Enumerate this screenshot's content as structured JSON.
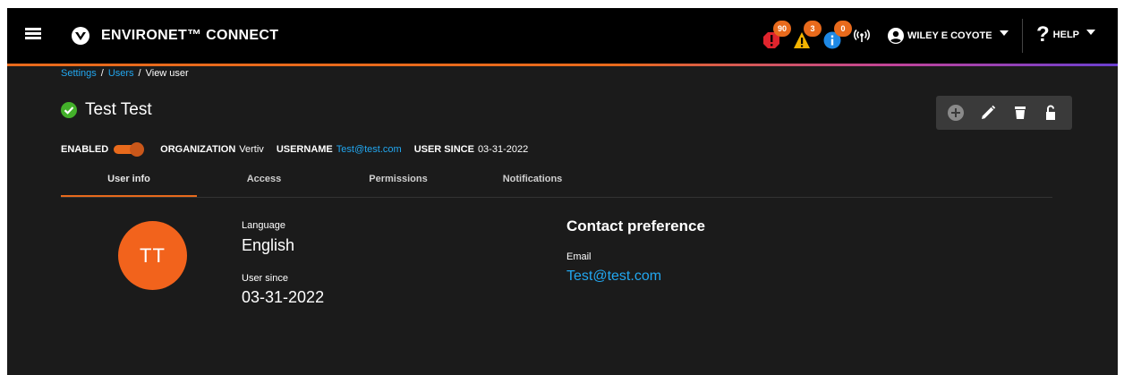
{
  "header": {
    "app_title": "ENVIRONET™ CONNECT",
    "alerts": [
      {
        "type": "critical",
        "icon": "critical-alarm-icon",
        "count": "90",
        "color": "#e0242d"
      },
      {
        "type": "warning",
        "icon": "warning-triangle-icon",
        "count": "3",
        "color": "#f4b400"
      },
      {
        "type": "info",
        "icon": "info-icon",
        "count": "0",
        "color": "#1e88e5"
      }
    ],
    "user_name": "WILEY E COYOTE",
    "help_label": "HELP"
  },
  "breadcrumb": {
    "items": [
      "Settings",
      "Users",
      "View user"
    ],
    "separator": "/"
  },
  "page_title": "Test Test",
  "toolbar": {
    "actions": [
      "add-icon",
      "edit-icon",
      "delete-icon",
      "unlock-icon"
    ]
  },
  "meta": {
    "enabled_label": "ENABLED",
    "enabled": true,
    "organization_label": "ORGANIZATION",
    "organization": "Vertiv",
    "username_label": "USERNAME",
    "username": "Test@test.com",
    "user_since_label": "USER SINCE",
    "user_since": "03-31-2022"
  },
  "tabs": [
    {
      "label": "User info",
      "active": true
    },
    {
      "label": "Access",
      "active": false
    },
    {
      "label": "Permissions",
      "active": false
    },
    {
      "label": "Notifications",
      "active": false
    }
  ],
  "user_info": {
    "avatar_initials": "TT",
    "language_label": "Language",
    "language": "English",
    "user_since_label": "User since",
    "user_since": "03-31-2022",
    "contact_title": "Contact preference",
    "email_label": "Email",
    "email": "Test@test.com"
  },
  "colors": {
    "accent": "#e86a1c",
    "link": "#22a7f0",
    "background": "#1b1b1b",
    "topbar": "#000000"
  }
}
